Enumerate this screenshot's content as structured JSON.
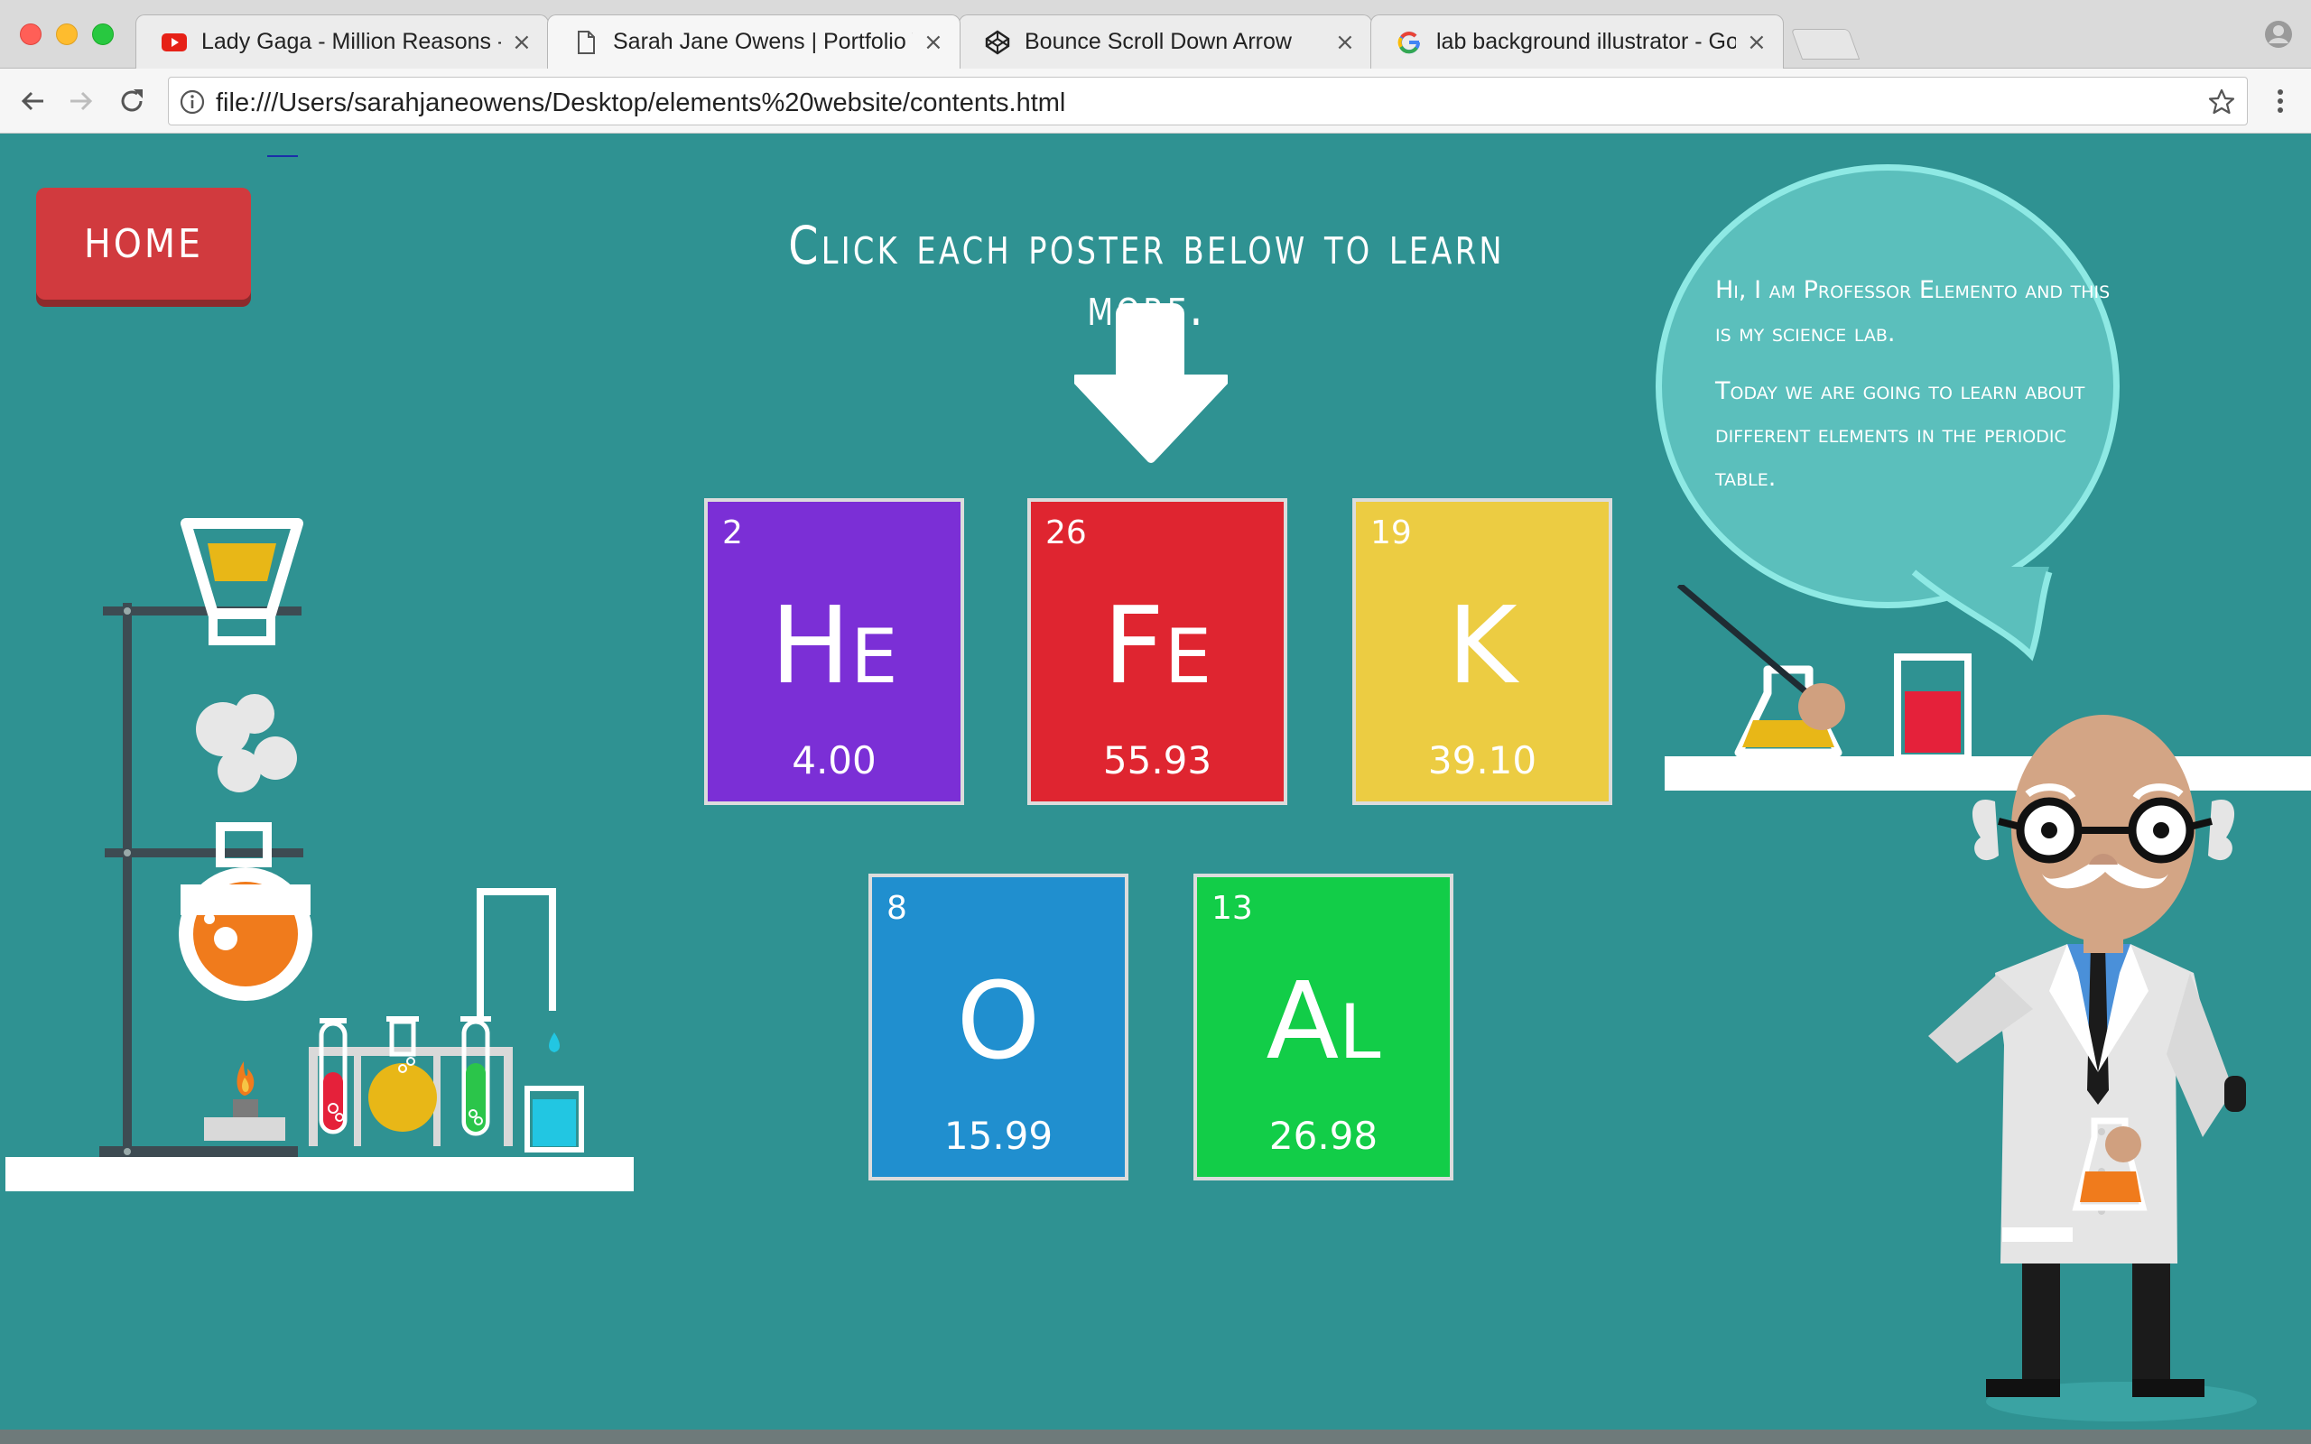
{
  "browser": {
    "tabs": [
      {
        "title": "Lady Gaga - Million Reasons -",
        "icon": "youtube-icon",
        "close": "×"
      },
      {
        "title": "Sarah Jane Owens | Portfolio W",
        "icon": "document-icon",
        "close": "×"
      },
      {
        "title": "Bounce Scroll Down Arrow",
        "icon": "codepen-icon",
        "close": "×"
      },
      {
        "title": "lab background illustrator - Go",
        "icon": "google-icon",
        "close": "×"
      }
    ],
    "url": "file:///Users/sarahjaneowens/Desktop/elements%20website/contents.html",
    "colors": {
      "close": "#ff5f57",
      "minimize": "#febc2e",
      "zoom": "#28c840"
    }
  },
  "page": {
    "home_label": "HOME",
    "instruction": "Click each poster below to learn more.",
    "elements": [
      {
        "number": "2",
        "symbol": "He",
        "mass": "4.00",
        "color": "#7b2fd6"
      },
      {
        "number": "26",
        "symbol": "Fe",
        "mass": "55.93",
        "color": "#df2530"
      },
      {
        "number": "19",
        "symbol": "K",
        "mass": "39.10",
        "color": "#eccc42"
      },
      {
        "number": "8",
        "symbol": "O",
        "mass": "15.99",
        "color": "#208fcf"
      },
      {
        "number": "13",
        "symbol": "Al",
        "mass": "26.98",
        "color": "#12cd48"
      }
    ],
    "speech": {
      "line1": "Hi, I am Professor Elemento and this is my science lab.",
      "line2": "Today we are going to learn about different elements in the periodic table."
    },
    "colors": {
      "background": "#2f9292",
      "home_button": "#d13a3e",
      "bubble": "#5bbfbc"
    }
  }
}
